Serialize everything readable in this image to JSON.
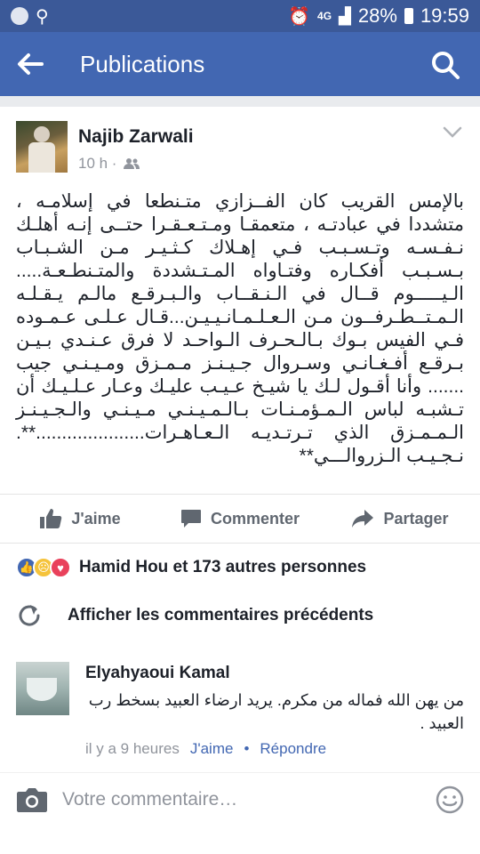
{
  "status": {
    "network": "4G",
    "battery": "28%",
    "time": "19:59"
  },
  "appbar": {
    "title": "Publications"
  },
  "post": {
    "author": "Najib Zarwali",
    "time": "10 h ·",
    "body": "بالإمس القريب كان الفــزازي متـنطعا في إسلامـه ، متشددا في عبادتـه ، متعمقـا ومـتـعـقـرا حتــى إنـه أهلـك نـفـسـه وتـسـبـب فـي إهـلاك كـثـيـر مـن الشـبـاب بـسـبـب أفكـاره وفتـاواه المـتـشددة والمتـنطـعـة..... الـيـــــوم قــال في الـنـقــاب والـبـرقـع مالـم يـقـلـه الـمـتــطـرفــون مـن الـعـلـمـانـيـيـن...قـال عـلـى عـمـوده فـي الفيس بـوك بـالـحـرف الـواحـد لا فرق عـنـدي بـيـن بـرقـع أفـغـانـي وسـروال جـيـنـز مـمـزق ومـيـنـي جيب ....... وأنا أقـول لـك يا شيـخ عـيـب عليـك وعـار عـلـيـك أن تـشبـه لباس الـمـؤمـنـات بـالـمـيـنـي مـيـنـي والـجـيـنـز الـمـمـزق الذي تـرتـديـه الـعـاهـرات.....................**. نـجـيـب الـزروالـــي**"
  },
  "actions": {
    "like": "J'aime",
    "comment": "Commenter",
    "share": "Partager"
  },
  "reactions": {
    "text": "Hamid Hou et 173 autres personnes"
  },
  "previous_comments": "Afficher les commentaires précédents",
  "comment": {
    "author": "Elyahyaoui Kamal",
    "text": "من يهن الله فماله من مكرم. يريد ارضاء العبيد بسخط رب العبيد .",
    "time": "il y a 9 heures",
    "like": "J'aime",
    "sep": "•",
    "reply": "Répondre"
  },
  "composer": {
    "placeholder": "Votre commentaire…"
  },
  "colors": {
    "brand": "#4267b2",
    "status_bar": "#3b5998",
    "like": "#4267b2",
    "love": "#e9415b",
    "sad": "#f5c33b"
  },
  "icons": [
    "back-arrow-icon",
    "search-icon",
    "chevron-down-icon",
    "friends-icon",
    "like-icon",
    "comment-icon",
    "share-icon",
    "refresh-icon",
    "camera-icon",
    "emoji-icon"
  ]
}
